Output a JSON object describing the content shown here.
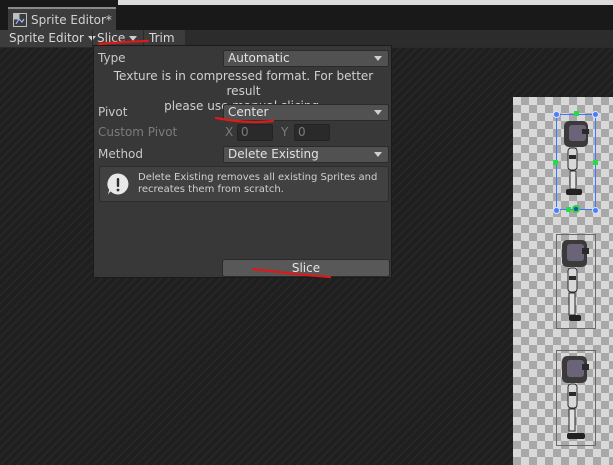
{
  "window": {
    "tab_title": "Sprite Editor*",
    "tab_icon": "sprite-editor-icon"
  },
  "toolbar": {
    "sprite_editor_label": "Sprite Editor",
    "slice_label": "Slice",
    "trim_label": "Trim"
  },
  "slice_popup": {
    "type_label": "Type",
    "type_value": "Automatic",
    "info_line1": "Texture is in compressed format. For better result",
    "info_line2": "please use manual slicing.",
    "pivot_label": "Pivot",
    "pivot_value": "Center",
    "custom_pivot_label": "Custom Pivot",
    "x_label": "X",
    "x_value": "0",
    "y_label": "Y",
    "y_value": "0",
    "method_label": "Method",
    "method_value": "Delete Existing",
    "help_text_line1": "Delete Existing removes all existing Sprites and",
    "help_text_line2": "recreates them from scratch.",
    "slice_button_label": "Slice"
  },
  "colors": {
    "annotation_red": "#e01818",
    "selection_blue": "#3c78ff",
    "handle_green": "#22dd44"
  }
}
